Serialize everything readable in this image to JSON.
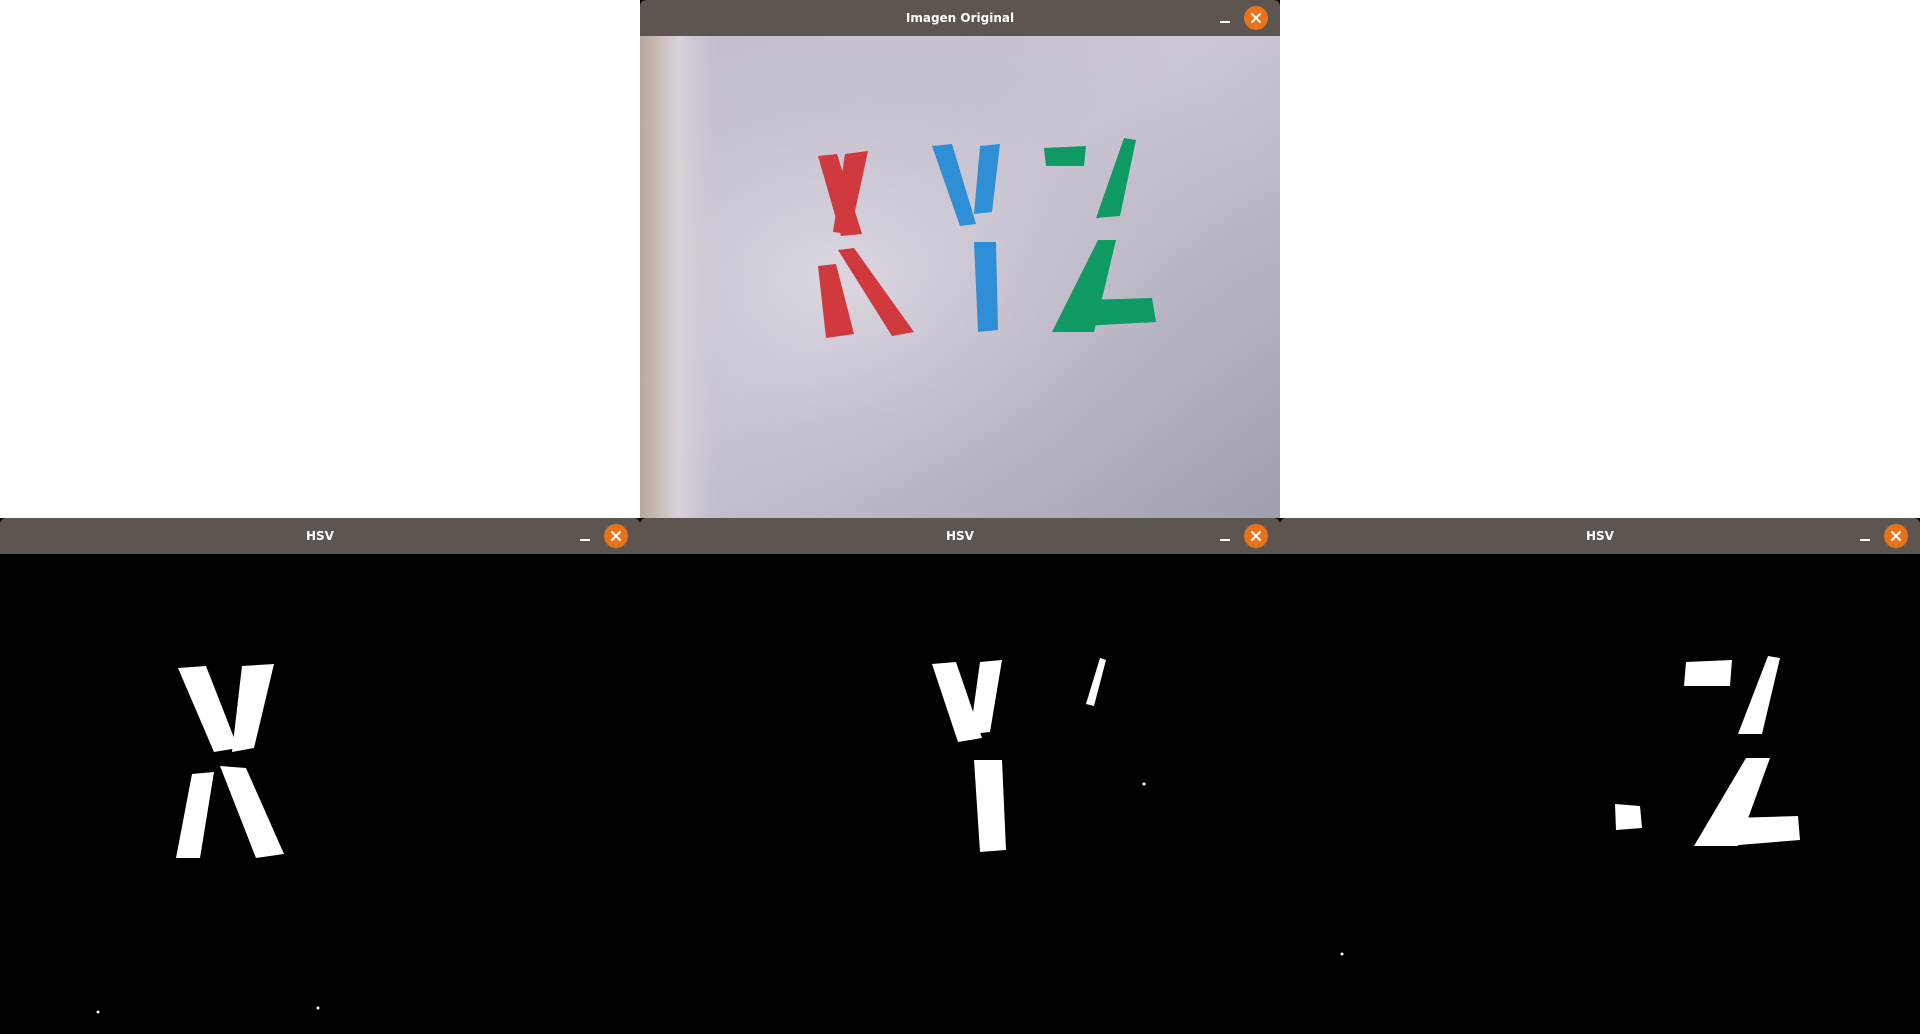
{
  "windows": {
    "original": {
      "title": "Imagen Original",
      "icon": "camera-image"
    },
    "hsv_x": {
      "title": "HSV",
      "icon": "mask-image",
      "mask": "red"
    },
    "hsv_y": {
      "title": "HSV",
      "icon": "mask-image",
      "mask": "blue"
    },
    "hsv_z": {
      "title": "HSV",
      "icon": "mask-image",
      "mask": "green"
    }
  },
  "icons": {
    "minimize": "minimize-icon",
    "close": "close-icon"
  },
  "colors": {
    "titlebar": "#5c5550",
    "close_button": "#e9731d",
    "letter_x": "#d03a3f",
    "letter_y": "#2f8fd6",
    "letter_z": "#0e9a62"
  }
}
